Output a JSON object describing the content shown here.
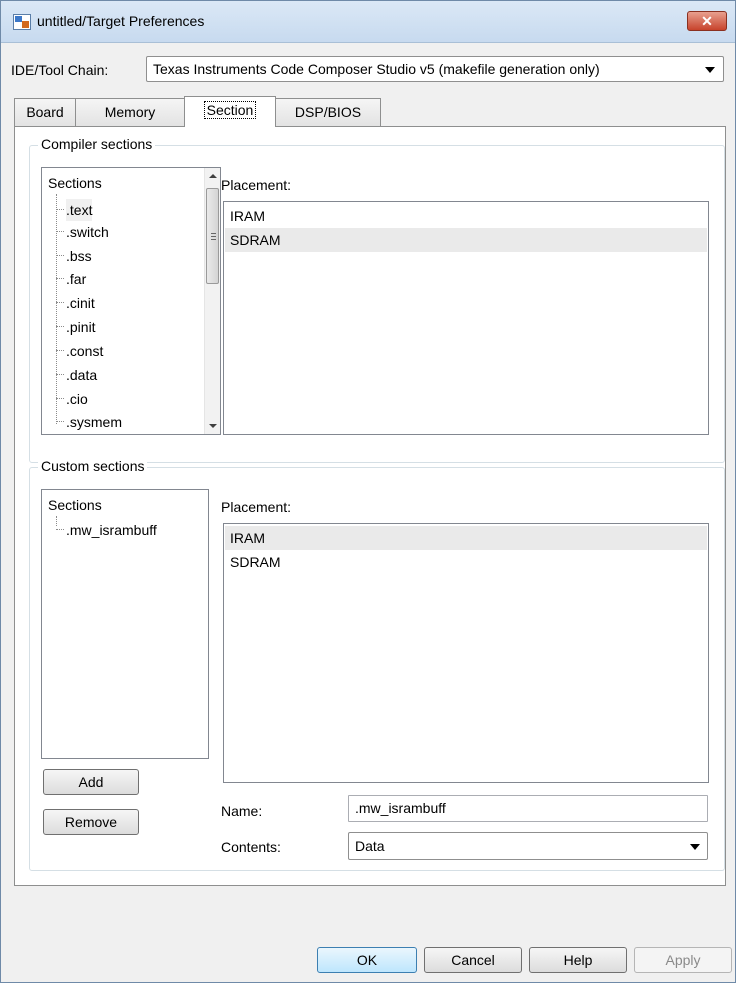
{
  "window": {
    "title": "untitled/Target Preferences",
    "close_glyph": "✕"
  },
  "toolchain": {
    "label": "IDE/Tool Chain:",
    "value": "Texas Instruments Code Composer Studio v5 (makefile generation only)"
  },
  "tabs": [
    {
      "label": "Board",
      "active": false
    },
    {
      "label": "Memory",
      "active": false
    },
    {
      "label": "Section",
      "active": true
    },
    {
      "label": "DSP/BIOS",
      "active": false
    }
  ],
  "compiler_sections": {
    "group_title": "Compiler sections",
    "list_header": "Sections",
    "items": [
      ".text",
      ".switch",
      ".bss",
      ".far",
      ".cinit",
      ".pinit",
      ".const",
      ".data",
      ".cio",
      ".sysmem"
    ],
    "selected": ".text",
    "placement_label": "Placement:",
    "placement_items": [
      "IRAM",
      "SDRAM"
    ],
    "placement_selected": "SDRAM"
  },
  "custom_sections": {
    "group_title": "Custom sections",
    "list_header": "Sections",
    "items": [
      ".mw_isrambuff"
    ],
    "placement_label": "Placement:",
    "placement_items": [
      "IRAM",
      "SDRAM"
    ],
    "placement_selected": "IRAM",
    "add_label": "Add",
    "remove_label": "Remove",
    "name_label": "Name:",
    "name_value": ".mw_isrambuff",
    "contents_label": "Contents:",
    "contents_value": "Data"
  },
  "footer": {
    "ok_label": "OK",
    "cancel_label": "Cancel",
    "help_label": "Help",
    "apply_label": "Apply"
  },
  "colors": {
    "titlebar": "#c7daef",
    "close_button": "#c7432c",
    "default_button": "#bee6fd",
    "selection": "#eaeaea"
  }
}
